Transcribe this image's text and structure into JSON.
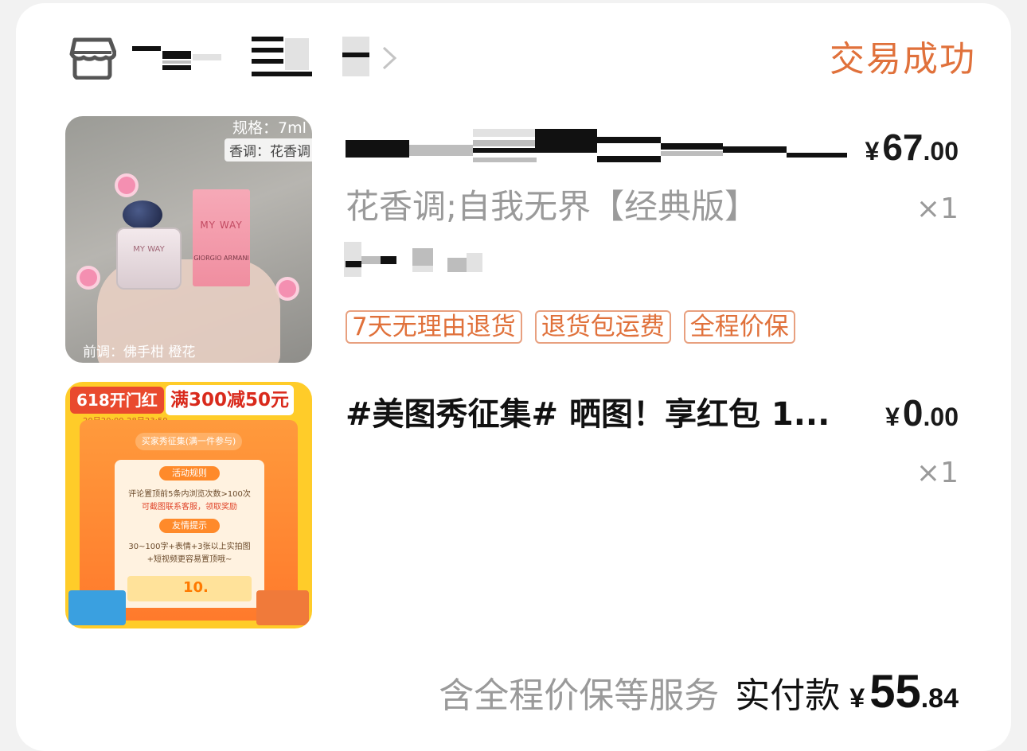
{
  "order": {
    "status": "交易成功",
    "store_icon": "store-icon",
    "chevron_icon": "chevron-right-icon"
  },
  "items": [
    {
      "title": "",
      "title_redacted": true,
      "price_currency": "¥",
      "price_int": "67",
      "price_dec": ".00",
      "spec": "花香调;自我无界【经典版】",
      "quantity": "×1",
      "tags": [
        "7天无理由退货",
        "退货包运费",
        "全程价保"
      ],
      "thumb": {
        "spec_text": "规格：7ml",
        "tone_text": "香调：花香调",
        "note_text": "前调：佛手柑 橙花",
        "box_brand": "MY WAY",
        "box_sub": "GIORGIO ARMANI",
        "bottle_text": "MY WAY"
      }
    },
    {
      "title": "#美图秀征集# 晒图！享红包 1...",
      "price_currency": "¥",
      "price_int": "0",
      "price_dec": ".00",
      "quantity": "×1",
      "thumb": {
        "banner_left": "618开门红",
        "banner_right": "满300减50元",
        "date": "20日20:00-28日23:59",
        "chip": "买家秀征集(满一件参与)",
        "rules_head": "活动规则",
        "rule_line1": "评论置顶前5条内浏览次数>100次",
        "rule_line2": "可截图联系客服，领取奖励",
        "tips_head": "友情提示",
        "tip_line1": "30~100字+表情+3张以上实拍图",
        "tip_line2": "+短视频更容易置顶哦~",
        "coupon_value": "10."
      }
    }
  ],
  "footer": {
    "service_note": "含全程价保等服务",
    "paid_label": "实付款",
    "currency": "¥",
    "total_int": "55",
    "total_dec": ".84"
  },
  "colors": {
    "accent": "#e0713b",
    "tag_border": "#e8a07f",
    "muted_text": "#9a9a9a",
    "background": "#f2f2f2"
  }
}
